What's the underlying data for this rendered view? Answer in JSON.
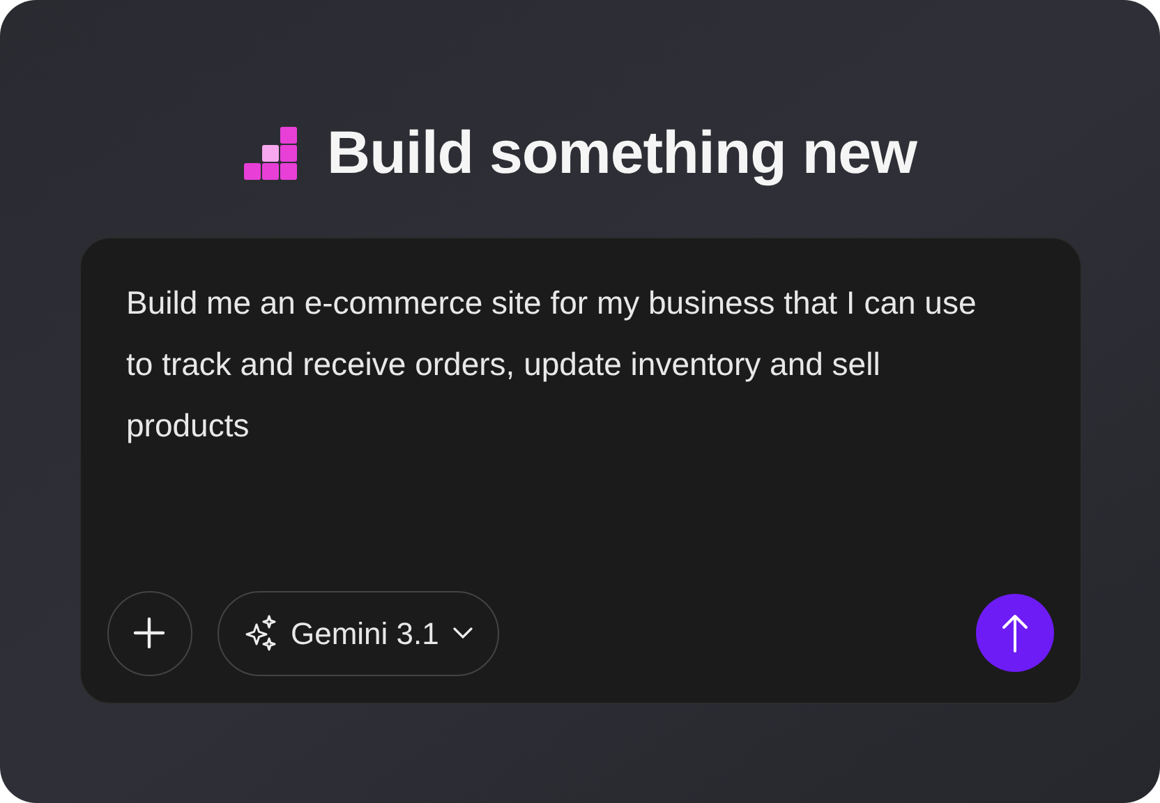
{
  "heading": "Build something new",
  "prompt": {
    "value": "Build me an e-commerce site for my business that I can use to track and receive orders, update inventory and sell products"
  },
  "model_selector": {
    "label": "Gemini 3.1"
  }
}
